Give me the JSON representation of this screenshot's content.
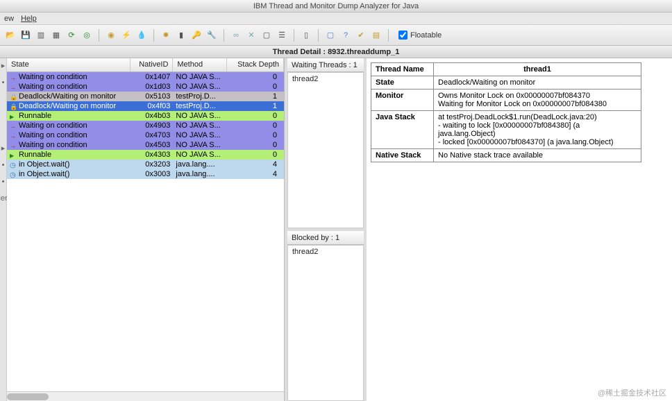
{
  "window": {
    "title": "IBM Thread and Monitor Dump Analyzer for Java"
  },
  "menu": {
    "view": "ew",
    "help": "Help"
  },
  "toolbar": {
    "floatable": "Floatable"
  },
  "detail": {
    "title": "Thread Detail : 8932.threaddump_1"
  },
  "leftlabel": "ler",
  "columns": {
    "state": "State",
    "nativeid": "NativeID",
    "method": "Method",
    "depth": "Stack Depth"
  },
  "rows": [
    {
      "icon": "arrow",
      "bg": "bgviolet",
      "state": "Waiting on condition",
      "nid": "0x1407",
      "method": "NO JAVA S...",
      "depth": "0"
    },
    {
      "icon": "arrow",
      "bg": "bgviolet",
      "state": "Waiting on condition",
      "nid": "0x1d03",
      "method": "NO JAVA S...",
      "depth": "0"
    },
    {
      "icon": "lock",
      "bg": "bgdeadlock",
      "state": "Deadlock/Waiting on monitor",
      "nid": "0x5103",
      "method": "testProj.D...",
      "depth": "1"
    },
    {
      "icon": "lock",
      "bg": "bgselected",
      "state": "Deadlock/Waiting on monitor",
      "nid": "0x4f03",
      "method": "testProj.D...",
      "depth": "1"
    },
    {
      "icon": "play",
      "bg": "bggreen",
      "state": "Runnable",
      "nid": "0x4b03",
      "method": "NO JAVA S...",
      "depth": "0"
    },
    {
      "icon": "arrow",
      "bg": "bgviolet",
      "state": "Waiting on condition",
      "nid": "0x4903",
      "method": "NO JAVA S...",
      "depth": "0"
    },
    {
      "icon": "arrow",
      "bg": "bgviolet",
      "state": "Waiting on condition",
      "nid": "0x4703",
      "method": "NO JAVA S...",
      "depth": "0"
    },
    {
      "icon": "arrow",
      "bg": "bgviolet",
      "state": "Waiting on condition",
      "nid": "0x4503",
      "method": "NO JAVA S...",
      "depth": "0"
    },
    {
      "icon": "play",
      "bg": "bggreen",
      "state": "Runnable",
      "nid": "0x4303",
      "method": "NO JAVA S...",
      "depth": "0"
    },
    {
      "icon": "clock",
      "bg": "bgblue",
      "state": "in Object.wait()",
      "nid": "0x3203",
      "method": "java.lang....",
      "depth": "4"
    },
    {
      "icon": "clock",
      "bg": "bgblue",
      "state": "in Object.wait()",
      "nid": "0x3003",
      "method": "java.lang....",
      "depth": "4"
    }
  ],
  "mid": {
    "waiting_label": "Waiting Threads : 1",
    "waiting_item": "thread2",
    "blocked_label": "Blocked by : 1",
    "blocked_item": "thread2"
  },
  "details": {
    "h_name": "Thread Name",
    "v_name": "thread1",
    "h_state": "State",
    "v_state": "Deadlock/Waiting on monitor",
    "h_monitor": "Monitor",
    "v_monitor": "Owns Monitor Lock on 0x00000007bf084370\nWaiting for Monitor Lock on 0x00000007bf084380",
    "h_jstack": "Java Stack",
    "v_jstack": "at testProj.DeadLock$1.run(DeadLock.java:20)\n- waiting to lock [0x00000007bf084380] (a java.lang.Object)\n- locked [0x00000007bf084370] (a java.lang.Object)",
    "h_nstack": "Native Stack",
    "v_nstack": "No Native stack trace available"
  },
  "watermark": "@稀土掘金技术社区"
}
